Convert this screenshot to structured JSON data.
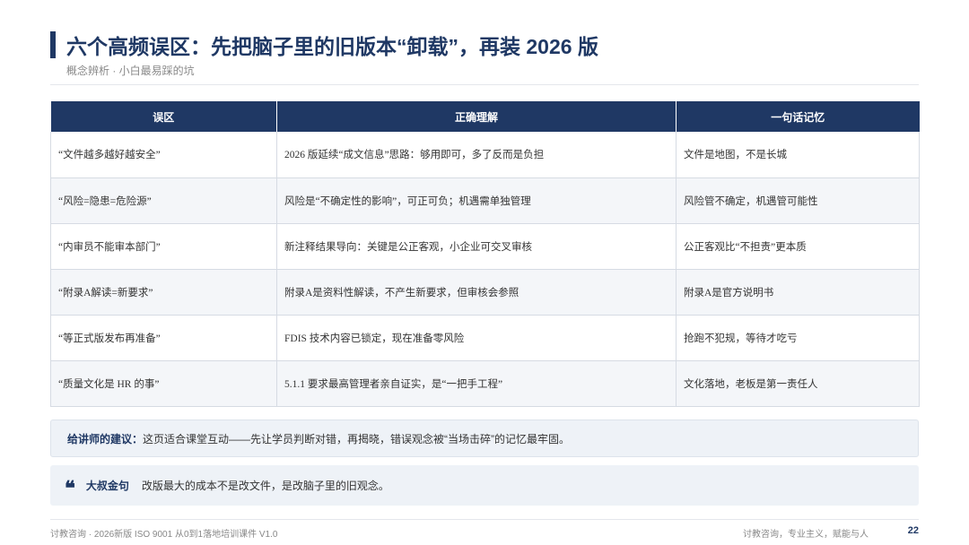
{
  "header": {
    "title": "六个高频误区：先把脑子里的旧版本“卸载”，再装 2026 版",
    "subtitle": "概念辨析 · 小白最易踩的坑"
  },
  "table": {
    "headers": [
      "误区",
      "正确理解",
      "一句话记忆"
    ],
    "rows": [
      [
        "“文件越多越好越安全”",
        "2026 版延续“成文信息”思路：够用即可，多了反而是负担",
        "文件是地图，不是长城"
      ],
      [
        "“风险=隐患=危险源”",
        "风险是“不确定性的影响”，可正可负；机遇需单独管理",
        "风险管不确定，机遇管可能性"
      ],
      [
        "“内审员不能审本部门”",
        "新注释结果导向：关键是公正客观，小企业可交叉审核",
        "公正客观比“不担责”更本质"
      ],
      [
        "“附录A解读=新要求”",
        "附录A是资料性解读，不产生新要求，但审核会参照",
        "附录A是官方说明书"
      ],
      [
        "“等正式版发布再准备”",
        "FDIS 技术内容已锁定，现在准备零风险",
        "抢跑不犯规，等待才吃亏"
      ],
      [
        "“质量文化是 HR 的事”",
        "5.1.1 要求最高管理者亲自证实，是“一把手工程”",
        "文化落地，老板是第一责任人"
      ]
    ]
  },
  "tip": {
    "label": "给讲师的建议：",
    "text": "这页适合课堂互动——先让学员判断对错，再揭晓，错误观念被“当场击碎”的记忆最牢固。"
  },
  "quote": {
    "icon": "quote-icon",
    "glyph": "❝",
    "label": "大叔金句",
    "text": "改版最大的成本不是改文件，是改脑子里的旧观念。"
  },
  "footer": {
    "left": "讨教咨询 · 2026新版 ISO 9001 从0到1落地培训课件 V1.0",
    "right": "讨教咨询，专业主义，赋能与人",
    "page": "22"
  },
  "colors": {
    "brand": "#1f3864",
    "panel": "#eef2f7"
  }
}
